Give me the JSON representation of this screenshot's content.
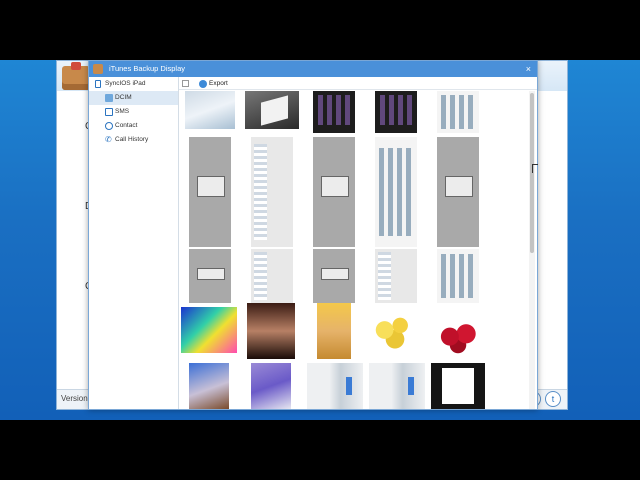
{
  "dialog": {
    "title": "iTunes Backup Display",
    "close_glyph": "×"
  },
  "toolbar": {
    "export_label": "Export"
  },
  "tree": {
    "device": "SyncIOS iPad",
    "items": [
      {
        "label": "DCIM",
        "icon": "image-icon",
        "selected": true
      },
      {
        "label": "SMS",
        "icon": "message-icon",
        "selected": false
      },
      {
        "label": "Contact",
        "icon": "contact-icon",
        "selected": false
      },
      {
        "label": "Call History",
        "icon": "phone-icon",
        "selected": false
      }
    ]
  },
  "background_app": {
    "letters": [
      "C",
      "D",
      "C"
    ],
    "footer_label": "Version"
  },
  "colors": {
    "desktop": "#1a6fc2",
    "titlebar": "#4a90d9",
    "selection": "#dde9f5"
  }
}
